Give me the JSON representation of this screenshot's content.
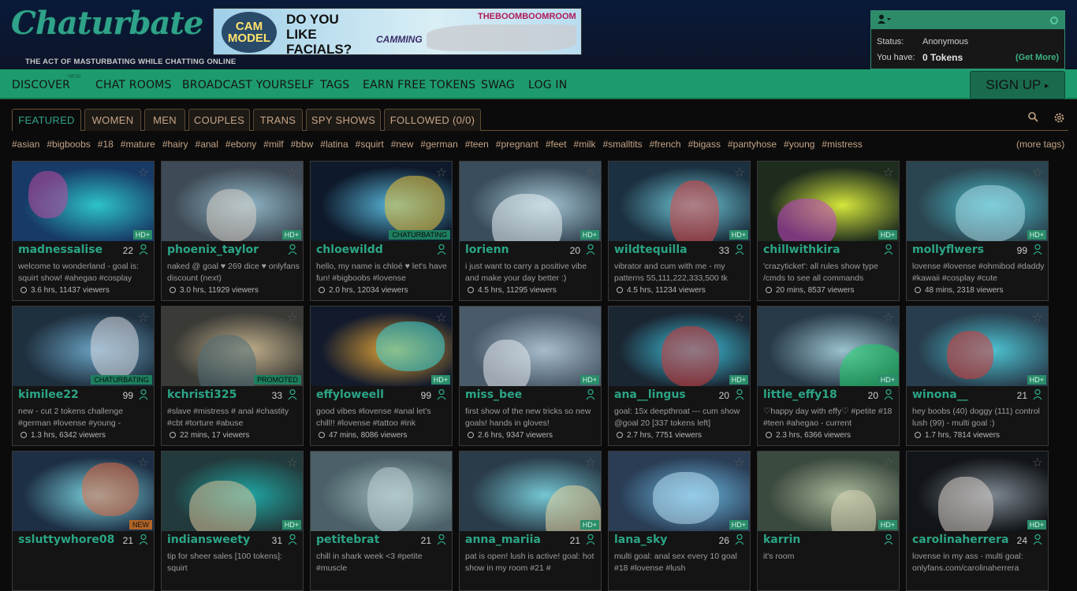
{
  "header": {
    "logo": "Chaturbate",
    "tagline": "THE ACT OF MASTURBATING WHILE CHATTING ONLINE",
    "banner": {
      "badge": "CAM MODEL",
      "headline_1": "DO YOU",
      "headline_2": "LIKE",
      "headline_3": "FACIALS?",
      "brand": "THEBOOMBOOMROOM",
      "sub": "CAMMING"
    }
  },
  "user": {
    "status_label": "Status:",
    "status_value": "Anonymous",
    "tokens_label": "You have:",
    "tokens_value": "0 Tokens",
    "get_more": "(Get More)"
  },
  "nav": {
    "discover": "DISCOVER",
    "new_badge": "NEW",
    "chat_rooms": "CHAT ROOMS",
    "broadcast": "BROADCAST YOURSELF",
    "tags": "TAGS",
    "earn": "EARN FREE TOKENS",
    "swag": "SWAG",
    "login": "LOG IN",
    "signup": "SIGN UP"
  },
  "tabs": [
    "FEATURED",
    "WOMEN",
    "MEN",
    "COUPLES",
    "TRANS",
    "SPY SHOWS",
    "FOLLOWED (0/0)"
  ],
  "hashtags": [
    "#asian",
    "#bigboobs",
    "#18",
    "#mature",
    "#hairy",
    "#anal",
    "#ebony",
    "#milf",
    "#bbw",
    "#latina",
    "#squirt",
    "#new",
    "#german",
    "#teen",
    "#pregnant",
    "#feet",
    "#milk",
    "#smalltits",
    "#french",
    "#bigass",
    "#pantyhose",
    "#young",
    "#mistress"
  ],
  "more_tags": "(more tags)",
  "rooms": [
    {
      "name": "madnessalise",
      "age": "22",
      "badge": "HD+",
      "subject": "welcome to wonderland - goal is: squirt show! #ahegao #cosplay",
      "meta": "3.6 hrs, 11437 viewers"
    },
    {
      "name": "phoenix_taylor",
      "age": "",
      "badge": "HD+",
      "subject": "naked @ goal ♥ 269 dice ♥ onlyfans discount (next)",
      "meta": "3.0 hrs, 11929 viewers"
    },
    {
      "name": "chloewildd",
      "age": "",
      "badge": "CHATURBATING",
      "subject": "hello, my name is chloé ♥ let's have fun! #bigboobs #lovense",
      "meta": "2.0 hrs, 12034 viewers"
    },
    {
      "name": "lorienn",
      "age": "20",
      "badge": "HD+",
      "subject": "i just want to carry a positive vibe and make your day better :)",
      "meta": "4.5 hrs, 11295 viewers"
    },
    {
      "name": "wildtequilla",
      "age": "33",
      "badge": "HD+",
      "subject": "vibrator and cum with me - my patterns 55,111,222,333,500 tk",
      "meta": "4.5 hrs, 11234 viewers"
    },
    {
      "name": "chillwithkira",
      "age": "",
      "badge": "HD+",
      "subject": "'crazyticket': all rules show type /cmds to see all commands",
      "meta": "20 mins, 8537 viewers"
    },
    {
      "name": "mollyflwers",
      "age": "99",
      "badge": "HD+",
      "subject": "lovense #lovense #ohmibod #daddy #kawaii #cosplay #cute",
      "meta": "48 mins, 2318 viewers"
    },
    {
      "name": "kimilee22",
      "age": "99",
      "badge": "CHATURBATING",
      "subject": "new - cut 2 tokens challenge #german #lovense #young -",
      "meta": "1.3 hrs, 6342 viewers"
    },
    {
      "name": "kchristi325",
      "age": "33",
      "badge": "PROMOTED",
      "subject": "#slave #mistress # anal #chastity #cbt #torture #abuse",
      "meta": "22 mins, 17 viewers"
    },
    {
      "name": "effyloweell",
      "age": "99",
      "badge": "HD+",
      "subject": "good vibes #lovense #anal let's chill!! #lovense #tattoo #ink",
      "meta": "47 mins, 8086 viewers"
    },
    {
      "name": "miss_bee",
      "age": "",
      "badge": "HD+",
      "subject": "first show of the new tricks so new goals! hands in gloves!",
      "meta": "2.6 hrs, 9347 viewers"
    },
    {
      "name": "ana__lingus",
      "age": "20",
      "badge": "HD+",
      "subject": "goal: 15x deepthroat --- cum show @goal 20 [337 tokens left]",
      "meta": "2.7 hrs, 7751 viewers"
    },
    {
      "name": "little_effy18",
      "age": "20",
      "badge": "HD+",
      "subject": "♡happy day with effy♡ #petite #18 #teen #ahegao - current",
      "meta": "2.3 hrs, 6366 viewers"
    },
    {
      "name": "winona__",
      "age": "21",
      "badge": "HD+",
      "subject": "hey boobs (40) doggy (111) control lush (99) - multi goal :)",
      "meta": "1.7 hrs, 7814 viewers"
    },
    {
      "name": "ssluttywhore08",
      "age": "21",
      "badge": "NEW",
      "subject": "",
      "meta": ""
    },
    {
      "name": "indiansweety",
      "age": "31",
      "badge": "HD+",
      "subject": "tip for sheer sales [100 tokens]: squirt",
      "meta": ""
    },
    {
      "name": "petitebrat",
      "age": "21",
      "badge": "",
      "subject": "chill in shark week <3 #petite #muscle",
      "meta": ""
    },
    {
      "name": "anna_mariia",
      "age": "21",
      "badge": "HD+",
      "subject": "pat is open! lush is active! goal: hot show in my room #21 #",
      "meta": ""
    },
    {
      "name": "lana_sky",
      "age": "26",
      "badge": "HD+",
      "subject": "multi goal: anal sex every 10 goal #18 #lovense #lush",
      "meta": ""
    },
    {
      "name": "karrin",
      "age": "",
      "badge": "HD+",
      "subject": "it's room",
      "meta": ""
    },
    {
      "name": "carolinaherrera",
      "age": "24",
      "badge": "HD+",
      "subject": "lovense in my ass - multi goal: onlyfans.com/carolinaherrera",
      "meta": ""
    }
  ],
  "colors": {
    "accent": "#1e9b6d",
    "name": "#2ba586",
    "tag": "#c4a486"
  }
}
